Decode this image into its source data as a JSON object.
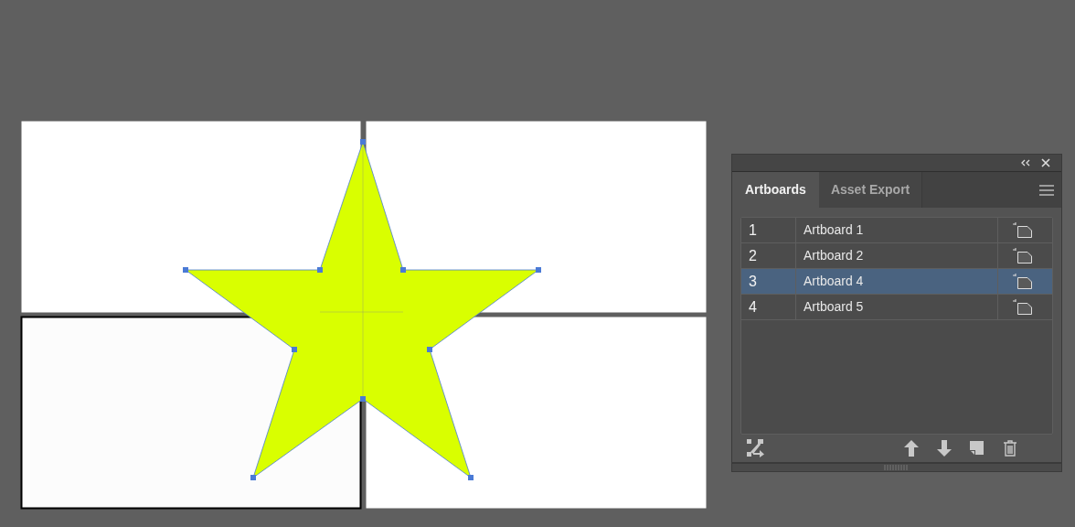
{
  "canvas": {
    "artboards": [
      {
        "selected": false
      },
      {
        "selected": false
      },
      {
        "selected": true
      },
      {
        "selected": false
      }
    ]
  },
  "panel": {
    "tabs": [
      {
        "label": "Artboards",
        "selected": true
      },
      {
        "label": "Asset Export",
        "selected": false
      }
    ],
    "rows": [
      {
        "number": "1",
        "name": "Artboard 1",
        "selected": false
      },
      {
        "number": "2",
        "name": "Artboard 2",
        "selected": false
      },
      {
        "number": "3",
        "name": "Artboard 4",
        "selected": true
      },
      {
        "number": "4",
        "name": "Artboard 5",
        "selected": false
      }
    ]
  }
}
